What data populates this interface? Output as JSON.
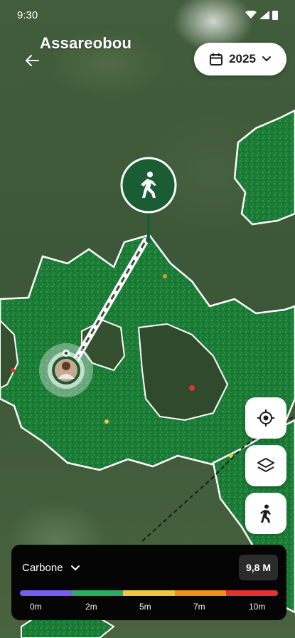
{
  "status_bar": {
    "time": "9:30"
  },
  "header": {
    "title": "Assareobou"
  },
  "year_selector": {
    "value": "2025"
  },
  "legend": {
    "metric": "Carbone",
    "value": "9,8 M",
    "scale_colors": [
      "#7a5cf0",
      "#27ae60",
      "#f4c542",
      "#f0901e",
      "#e5322d"
    ],
    "ticks": [
      "0m",
      "2m",
      "5m",
      "7m",
      "10m"
    ]
  },
  "map": {
    "forest_color": "#167a35",
    "path_color": "#ffffff",
    "marker_color": "#1a5c33"
  }
}
